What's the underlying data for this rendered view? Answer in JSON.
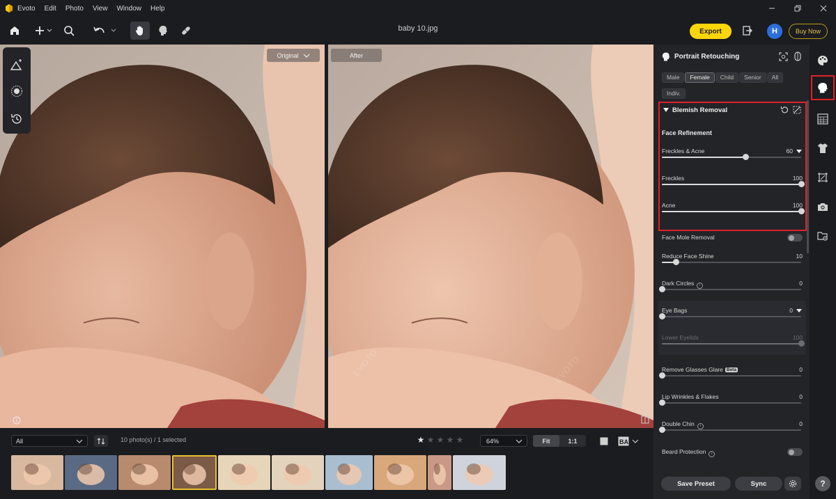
{
  "app": {
    "name": "Evoto",
    "file_name": "baby 10.jpg"
  },
  "menu": [
    "Evoto",
    "Edit",
    "Photo",
    "View",
    "Window",
    "Help"
  ],
  "toolbar": {
    "export_label": "Export",
    "avatar_letter": "H",
    "buy_label": "Buy Now"
  },
  "canvas": {
    "original_label": "Original",
    "after_label": "After",
    "watermark": "EVOTO"
  },
  "filmstrip": {
    "filter_value": "All",
    "count_text": "10 photo(s) / 1 selected",
    "rating": 1,
    "max_rating": 5,
    "zoom_value": "64%",
    "fit_label": "Fit",
    "one_to_one_label": "1:1",
    "thumbnails": [
      {
        "name": "thumb-1",
        "tone": "#d9b8a0"
      },
      {
        "name": "thumb-2",
        "tone": "#5a6a85"
      },
      {
        "name": "thumb-3",
        "tone": "#b88a6e"
      },
      {
        "name": "thumb-4",
        "tone": "#7b5a48",
        "selected": true
      },
      {
        "name": "thumb-5",
        "tone": "#e6d5b8"
      },
      {
        "name": "thumb-6",
        "tone": "#e3d3bd"
      },
      {
        "name": "thumb-7",
        "tone": "#a9bed0"
      },
      {
        "name": "thumb-8",
        "tone": "#d8a77a"
      },
      {
        "name": "thumb-9",
        "tone": "#c99886"
      },
      {
        "name": "thumb-10",
        "tone": "#cfd3dc"
      }
    ]
  },
  "panel": {
    "title": "Portrait Retouching",
    "chips": [
      {
        "label": "Male",
        "active": false
      },
      {
        "label": "Female",
        "active": true
      },
      {
        "label": "Child",
        "active": false
      },
      {
        "label": "Senior",
        "active": false
      },
      {
        "label": "All",
        "active": false
      },
      {
        "label": "Indiv.",
        "active": false
      }
    ],
    "section_title": "Blemish Removal",
    "sub_title": "Face Refinement",
    "sliders": [
      {
        "label": "Freckles & Acne",
        "value": "60",
        "fraction": 0.6,
        "has_dropdown": true
      },
      {
        "label": "Freckles",
        "value": "100",
        "fraction": 1.0
      },
      {
        "label": "Acne",
        "value": "100",
        "fraction": 1.0
      },
      {
        "label": "Reduce Face Shine",
        "value": "10",
        "fraction": 0.1
      },
      {
        "label": "Dark Circles",
        "value": "0",
        "fraction": 0
      },
      {
        "label": "Eye Bags",
        "value": "0",
        "fraction": 0,
        "has_dropdown": true
      },
      {
        "label": "Lower Eyelids",
        "value": "100",
        "fraction": 1.0,
        "disabled": true
      },
      {
        "label": "Remove Glasses Glare",
        "value": "0",
        "fraction": 0,
        "badge": "Beta"
      },
      {
        "label": "Lip Wrinkles & Flakes",
        "value": "0",
        "fraction": 0
      },
      {
        "label": "Double Chin",
        "value": "0",
        "fraction": 0
      }
    ],
    "toggles": [
      {
        "label": "Face Mole Removal",
        "on": false
      },
      {
        "label": "Beard Protection",
        "on": false
      }
    ],
    "save_preset_label": "Save Preset",
    "sync_label": "Sync"
  },
  "rail": {
    "help_label": "?"
  },
  "colors": {
    "accent_yellow": "#ffd60a",
    "highlight_red": "#e0202a",
    "panel_bg": "#232428",
    "app_bg": "#1b1c1f"
  }
}
